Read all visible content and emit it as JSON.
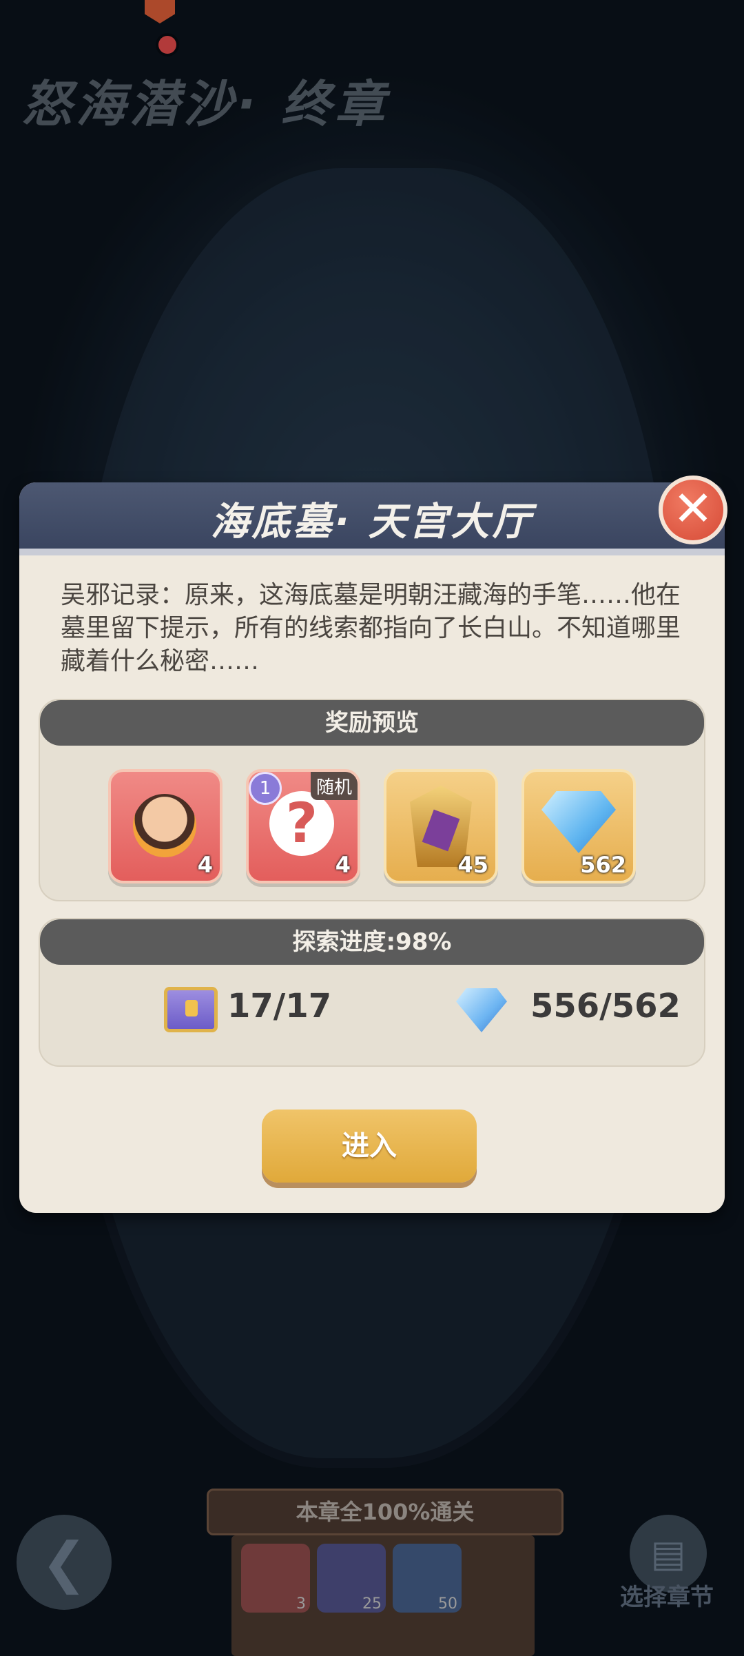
{
  "chapter": {
    "title": "怒海潜沙· 终章"
  },
  "dialog": {
    "title": "海底墓· 天宫大厅",
    "close_icon": "close-x-icon",
    "description": "吴邪记录：原来，这海底墓是明朝汪藏海的手笔……他在墓里留下提示，所有的线索都指向了长白山。不知道哪里藏着什么秘密……",
    "rewards": {
      "title": "奖励预览",
      "items": [
        {
          "icon": "hero-portrait-icon",
          "count": "4"
        },
        {
          "icon": "question-mark-icon",
          "badge": "1",
          "tag": "随机",
          "count": "4"
        },
        {
          "icon": "golden-mask-icon",
          "count": "45"
        },
        {
          "icon": "diamond-icon",
          "count": "562"
        }
      ]
    },
    "progress": {
      "title": "探索进度:98%",
      "chest_icon": "treasure-chest-icon",
      "chests": "17/17",
      "gem_icon": "diamond-icon",
      "gems": "556/562"
    },
    "enter_label": "进入"
  },
  "bottom": {
    "board_title": "本章全100%通关",
    "slots": [
      {
        "icon": "hero-portrait-icon",
        "count": "3"
      },
      {
        "icon": "shovel-icon",
        "count": "25"
      },
      {
        "icon": "hourglass-icon",
        "count": "50"
      }
    ],
    "back_icon": "back-arrow-icon",
    "chapter_select_label": "选择章节"
  },
  "colors": {
    "dialog_bg": "#efe9de",
    "header_bg": "#3a4560",
    "close_red": "#d64a36",
    "button_gold": "#e0a93a"
  }
}
